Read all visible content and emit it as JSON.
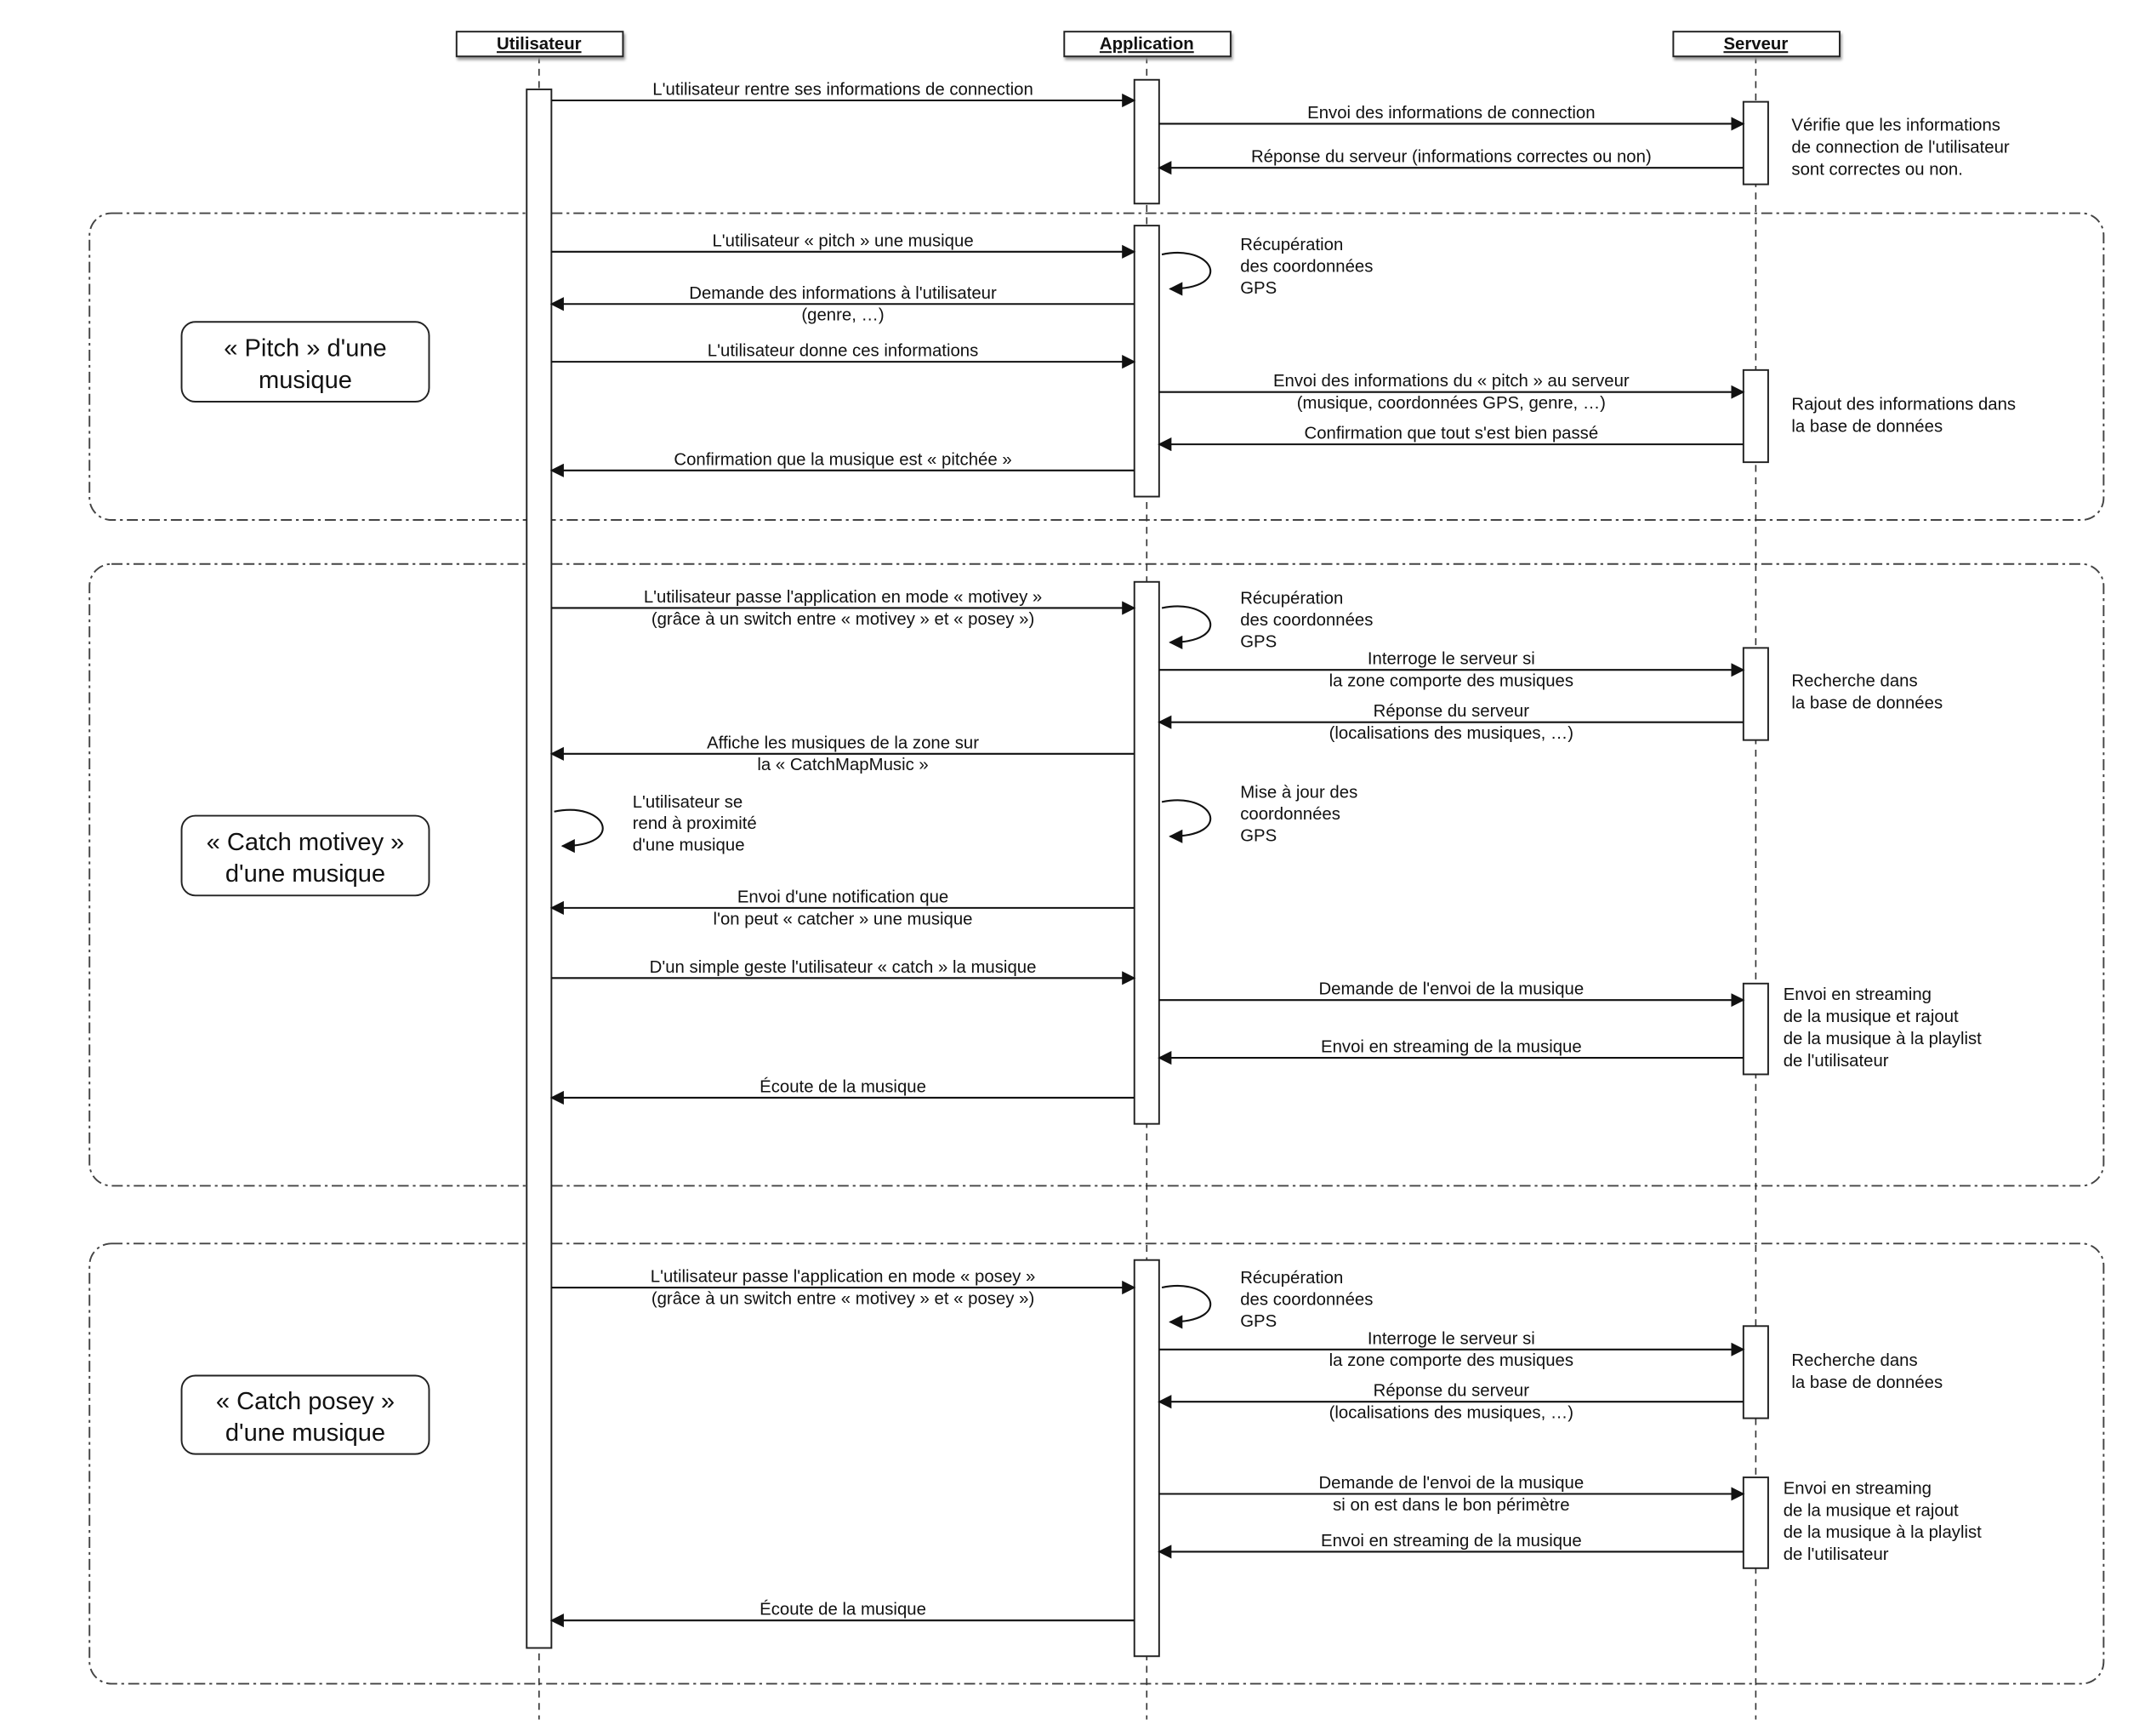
{
  "participants": [
    "Utilisateur",
    "Application",
    "Serveur"
  ],
  "messages": [
    {
      "lines": [
        "L'utilisateur rentre ses informations de connection"
      ]
    },
    {
      "lines": [
        "Envoi des informations de connection"
      ]
    },
    {
      "lines": [
        "Réponse du serveur (informations correctes ou non)"
      ]
    },
    {
      "lines": [
        "L'utilisateur « pitch » une musique"
      ]
    },
    {
      "lines": [
        "Demande des informations à l'utilisateur",
        "(genre, …)"
      ]
    },
    {
      "lines": [
        "L'utilisateur donne ces informations"
      ]
    },
    {
      "lines": [
        "Envoi des informations du « pitch » au serveur",
        "(musique, coordonnées GPS, genre, …)"
      ]
    },
    {
      "lines": [
        "Confirmation que tout s'est bien passé"
      ]
    },
    {
      "lines": [
        "Confirmation que la musique est « pitchée »"
      ]
    },
    {
      "lines": [
        "L'utilisateur passe l'application en mode « motivey »",
        "(grâce à un switch entre « motivey » et « posey »)"
      ]
    },
    {
      "lines": [
        "Interroge le serveur si",
        "la zone comporte des musiques"
      ]
    },
    {
      "lines": [
        "Réponse du serveur",
        "(localisations des musiques, …)"
      ]
    },
    {
      "lines": [
        "Affiche les musiques de la zone sur",
        "la « CatchMapMusic »"
      ]
    },
    {
      "lines": [
        "Envoi d'une notification que",
        "l'on peut « catcher » une musique"
      ]
    },
    {
      "lines": [
        "D'un simple geste l'utilisateur « catch » la musique"
      ]
    },
    {
      "lines": [
        "Demande de l'envoi de la musique"
      ]
    },
    {
      "lines": [
        "Envoi en streaming de la musique"
      ]
    },
    {
      "lines": [
        "Écoute de la musique"
      ]
    },
    {
      "lines": [
        "L'utilisateur passe l'application en mode « posey »",
        "(grâce à un switch entre « motivey » et « posey »)"
      ]
    },
    {
      "lines": [
        "Interroge le serveur si",
        "la zone comporte des musiques"
      ]
    },
    {
      "lines": [
        "Réponse du serveur",
        "(localisations des musiques, …)"
      ]
    },
    {
      "lines": [
        "Demande de l'envoi de la musique",
        "si on est dans le bon périmètre"
      ]
    },
    {
      "lines": [
        "Envoi en streaming de la musique"
      ]
    },
    {
      "lines": [
        "Écoute de la musique"
      ]
    }
  ],
  "self_messages": [
    {
      "lines": [
        "Récupération",
        "des coordonnées",
        "GPS"
      ]
    },
    {
      "lines": [
        "Récupération",
        "des coordonnées",
        "GPS"
      ]
    },
    {
      "lines": [
        "L'utilisateur se",
        "rend à proximité",
        "d'une musique"
      ]
    },
    {
      "lines": [
        "Mise à jour des",
        "coordonnées",
        "GPS"
      ]
    },
    {
      "lines": [
        "Récupération",
        "des coordonnées",
        "GPS"
      ]
    }
  ],
  "notes": [
    {
      "lines": [
        "Vérifie que les informations",
        "de connection de l'utilisateur",
        "sont correctes ou non."
      ]
    },
    {
      "lines": [
        "Rajout des informations dans",
        "la base de données"
      ]
    },
    {
      "lines": [
        "Recherche dans",
        "la base de données"
      ]
    },
    {
      "lines": [
        "Envoi en streaming",
        "de la musique et rajout",
        "de la musique à la playlist",
        "de l'utilisateur"
      ]
    },
    {
      "lines": [
        "Recherche dans",
        "la base de données"
      ]
    },
    {
      "lines": [
        "Envoi en streaming",
        "de la musique et rajout",
        "de la musique à la playlist",
        "de l'utilisateur"
      ]
    }
  ],
  "frames": [
    {
      "lines": [
        "« Pitch » d'une",
        "musique"
      ]
    },
    {
      "lines": [
        "« Catch motivey »",
        "d'une musique"
      ]
    },
    {
      "lines": [
        "« Catch posey »",
        "d'une musique"
      ]
    }
  ]
}
